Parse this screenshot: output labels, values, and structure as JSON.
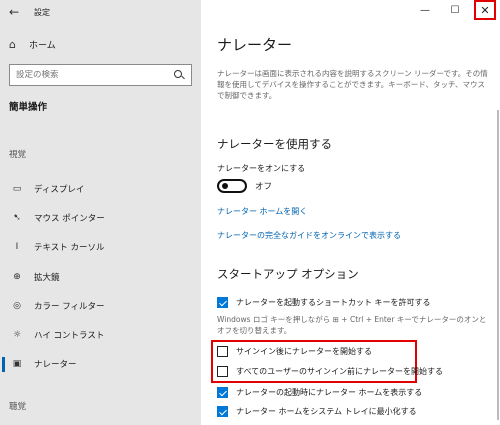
{
  "window": {
    "title": "設定",
    "minimize": "—",
    "maximize": "☐",
    "close": "✕"
  },
  "sidebar": {
    "back": "←",
    "home": "ホーム",
    "search_placeholder": "設定の検索",
    "section_title": "簡単操作",
    "vision_header": "視覚",
    "items": [
      {
        "label": "ディスプレイ",
        "icon": "display-icon"
      },
      {
        "label": "マウス ポインター",
        "icon": "mouse-pointer-icon"
      },
      {
        "label": "テキスト カーソル",
        "icon": "text-cursor-icon"
      },
      {
        "label": "拡大鏡",
        "icon": "magnifier-icon"
      },
      {
        "label": "カラー フィルター",
        "icon": "color-filter-icon"
      },
      {
        "label": "ハイ コントラスト",
        "icon": "high-contrast-icon"
      },
      {
        "label": "ナレーター",
        "icon": "narrator-icon",
        "active": true
      }
    ],
    "audio_header": "聴覚"
  },
  "main": {
    "title": "ナレーター",
    "description": "ナレーターは画面に表示される内容を説明するスクリーン リーダーです。その情報を使用してデバイスを操作することができます。キーボード、タッチ、マウスで制御できます。",
    "use_header": "ナレーターを使用する",
    "toggle_label": "ナレーターをオンにする",
    "toggle_state": "オフ",
    "link_home": "ナレーター ホームを開く",
    "link_guide": "ナレーターの完全なガイドをオンラインで表示する",
    "startup_header": "スタートアップ オプション",
    "cb_shortcut": "ナレーターを起動するショートカット キーを許可する",
    "shortcut_note": "Windows ロゴ キーを押しながら ⊞ + Ctrl + Enter キーでナレーターのオンとオフを切り替えます。",
    "cb_after_signin": "サインイン後にナレーターを開始する",
    "cb_before_signin": "すべてのユーザーのサインイン前にナレーターを開始する",
    "cb_show_home": "ナレーターの起動時にナレーター ホームを表示する",
    "cb_minimize_tray": "ナレーター ホームをシステム トレイに最小化する"
  },
  "colors": {
    "accent": "#0078d7",
    "link": "#0063b1",
    "highlight": "#e30000"
  }
}
